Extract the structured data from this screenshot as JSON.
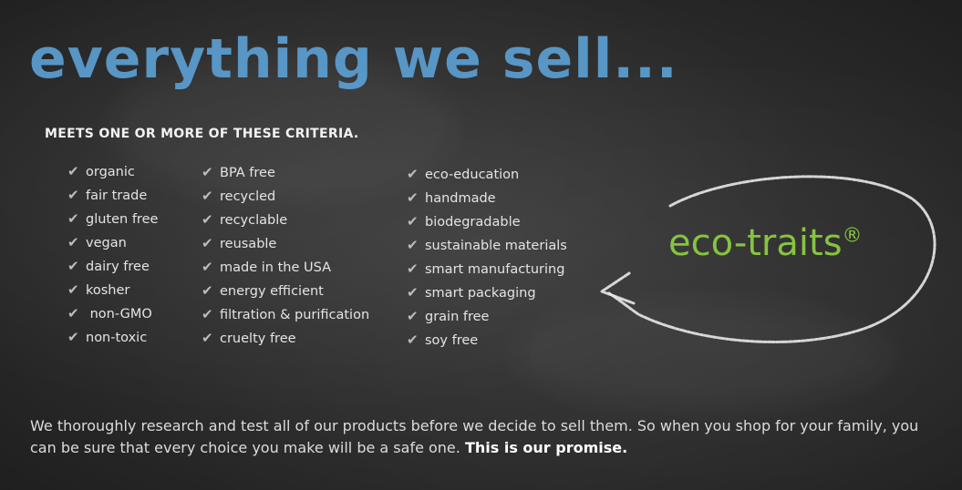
{
  "headline": "everything we sell...",
  "subhead": "MEETS ONE OR MORE OF THESE CRITERIA.",
  "check_glyph": "✔",
  "columns": [
    [
      "organic",
      "fair trade",
      "gluten free",
      "vegan",
      "dairy free",
      "kosher",
      " non-GMO",
      "non-toxic"
    ],
    [
      "BPA free",
      "recycled",
      "recyclable",
      "reusable",
      "made in the USA",
      "energy efficient",
      "filtration & purification",
      "cruelty free"
    ],
    [
      "eco-education",
      "handmade",
      "biodegradable",
      "sustainable materials",
      "smart manufacturing",
      "smart packaging",
      "grain free",
      "soy free"
    ]
  ],
  "eco_traits": {
    "label": "eco-traits",
    "mark": "®"
  },
  "paragraph": {
    "body": "We thoroughly research and test all of our products before we decide to sell them. So when you shop for your family, you can be sure that every choice you make will be a safe one. ",
    "promise": "This is our promise."
  },
  "colors": {
    "headline": "#5b9fd2",
    "eco_traits": "#86c440",
    "chalk": "#e4e4e4",
    "board": "#2c2c2c"
  }
}
